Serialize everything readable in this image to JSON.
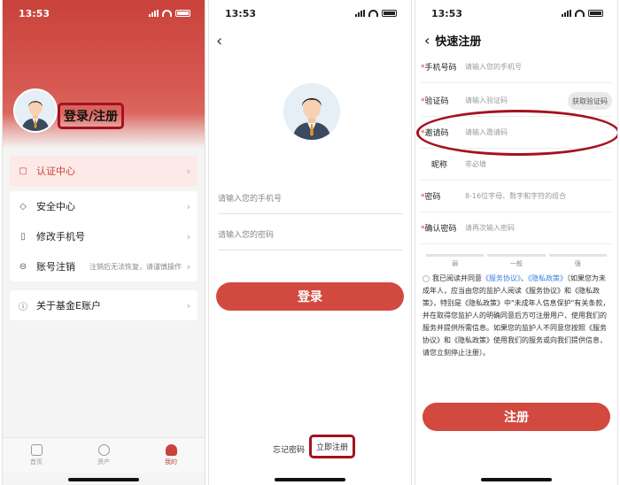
{
  "status_bar": {
    "time": "13:53"
  },
  "screen1": {
    "login_title": "登录/注册",
    "menu": [
      {
        "label": "认证中心",
        "icon": "certificate-icon"
      },
      {
        "label": "安全中心",
        "icon": "shield-icon"
      },
      {
        "label": "修改手机号",
        "icon": "phone-icon"
      },
      {
        "label": "账号注销",
        "icon": "minus-circle-icon",
        "note": "注销后无法恢复，请谨慎操作"
      },
      {
        "label": "关于基金E账户",
        "icon": "info-icon"
      }
    ],
    "nav": [
      {
        "label": "首页"
      },
      {
        "label": "资产"
      },
      {
        "label": "我的"
      }
    ]
  },
  "screen2": {
    "phone_placeholder": "请输入您的手机号",
    "password_placeholder": "请输入您的密码",
    "login_button": "登录",
    "forgot_password": "忘记密码",
    "register_now": "立即注册"
  },
  "screen3": {
    "title": "快速注册",
    "fields": {
      "phone": {
        "label": "手机号码",
        "placeholder": "请输入您的手机号"
      },
      "code": {
        "label": "验证码",
        "placeholder": "请输入验证码",
        "button": "获取验证码"
      },
      "invite": {
        "label": "邀请码",
        "placeholder": "请输入邀请码"
      },
      "nickname": {
        "label": "昵称",
        "placeholder": "非必填"
      },
      "password": {
        "label": "密码",
        "placeholder": "8-16位字母、数字和字符的组合"
      },
      "confirm": {
        "label": "确认密码",
        "placeholder": "请再次输入密码"
      }
    },
    "strength": [
      "弱",
      "一般",
      "强"
    ],
    "agreement": {
      "pre": "我已阅读并同意",
      "service": "《服务协议》",
      "sep": "、",
      "privacy": "《隐私政策》",
      "body": "（如果您为未成年人，应当由您的监护人阅读《服务协议》和《隐私政策》，特别是《隐私政策》中\"未成年人信息保护\"有关条款，并在取得您监护人的明确同意后方可注册用户、使用我们的服务并提供所需信息。如果您的监护人不同意您按照《服务协议》和《隐私政策》使用我们的服务或向我们提供信息，请您立刻停止注册）。"
    },
    "register_button": "注册"
  }
}
